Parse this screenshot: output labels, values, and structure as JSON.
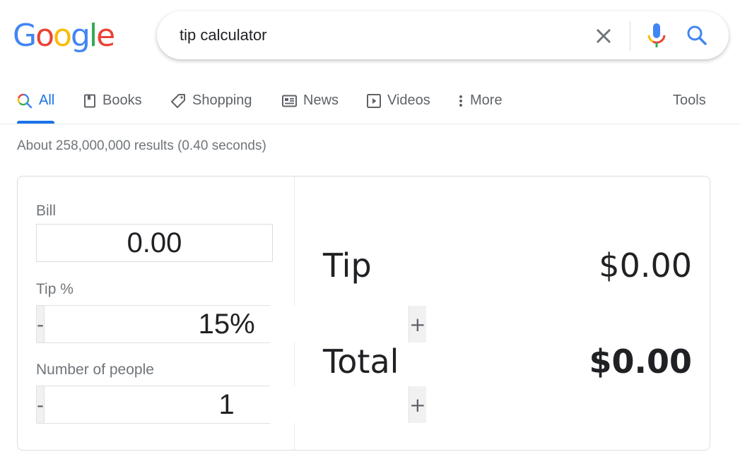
{
  "logo": {
    "letters": [
      {
        "char": "G",
        "color": "#4285f4"
      },
      {
        "char": "o",
        "color": "#ea4335"
      },
      {
        "char": "o",
        "color": "#fbbc05"
      },
      {
        "char": "g",
        "color": "#4285f4"
      },
      {
        "char": "l",
        "color": "#34a853"
      },
      {
        "char": "e",
        "color": "#ea4335"
      }
    ]
  },
  "search": {
    "query": "tip calculator",
    "clear_icon": "close-icon",
    "voice_icon": "microphone-icon",
    "search_icon": "magnifier-icon"
  },
  "tabs": [
    {
      "label": "All",
      "icon": "google-search-icon",
      "active": true
    },
    {
      "label": "Books",
      "icon": "book-icon",
      "active": false
    },
    {
      "label": "Shopping",
      "icon": "tag-icon",
      "active": false
    },
    {
      "label": "News",
      "icon": "newspaper-icon",
      "active": false
    },
    {
      "label": "Videos",
      "icon": "play-icon",
      "active": false
    },
    {
      "label": "More",
      "icon": "more-vert-icon",
      "active": false
    }
  ],
  "tools_label": "Tools",
  "result_stats": "About 258,000,000 results (0.40 seconds)",
  "calculator": {
    "bill_label": "Bill",
    "bill_value": "0.00",
    "tip_label": "Tip %",
    "tip_value": "15%",
    "people_label": "Number of people",
    "people_value": "1",
    "minus_label": "-",
    "plus_label": "+",
    "tip_result_label": "Tip",
    "tip_result_value": "$0.00",
    "total_label": "Total",
    "total_value": "$0.00"
  },
  "colors": {
    "accent": "#1a73e8",
    "text_primary": "#202124",
    "text_secondary": "#70757a"
  }
}
